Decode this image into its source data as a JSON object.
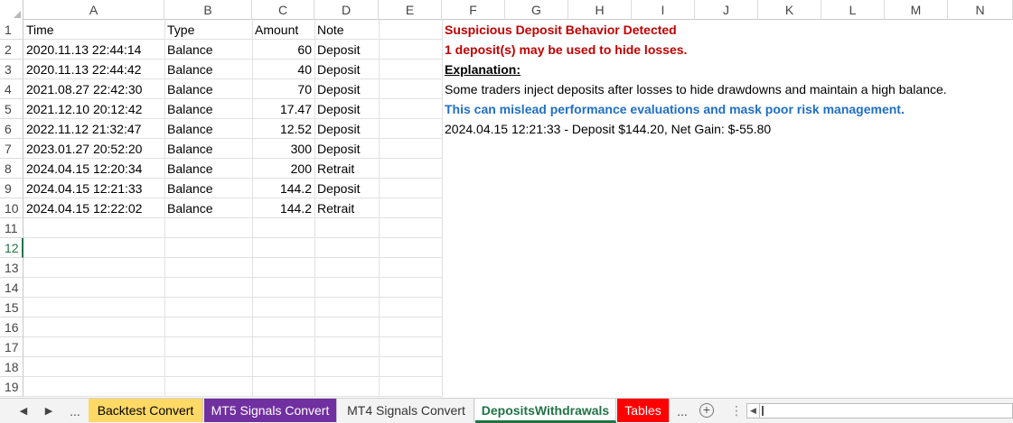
{
  "columns": [
    "A",
    "B",
    "C",
    "D",
    "E",
    "F",
    "G",
    "H",
    "I",
    "J",
    "K",
    "L",
    "M",
    "N"
  ],
  "rows": [
    "1",
    "2",
    "3",
    "4",
    "5",
    "6",
    "7",
    "8",
    "9",
    "10",
    "11",
    "12",
    "13",
    "14",
    "15",
    "16",
    "17",
    "18",
    "19"
  ],
  "active_row": "12",
  "table": {
    "headers": [
      "Time",
      "Type",
      "Amount",
      "Note"
    ],
    "records": [
      [
        "2020.11.13 22:44:14",
        "Balance",
        "60",
        "Deposit"
      ],
      [
        "2020.11.13 22:44:42",
        "Balance",
        "40",
        "Deposit"
      ],
      [
        "2021.08.27 22:42:30",
        "Balance",
        "70",
        "Deposit"
      ],
      [
        "2021.12.10 20:12:42",
        "Balance",
        "17.47",
        "Deposit"
      ],
      [
        "2022.11.12 21:32:47",
        "Balance",
        "12.52",
        "Deposit"
      ],
      [
        "2023.01.27 20:52:20",
        "Balance",
        "300",
        "Deposit"
      ],
      [
        "2024.04.15 12:20:34",
        "Balance",
        "200",
        "Retrait"
      ],
      [
        "2024.04.15 12:21:33",
        "Balance",
        "144.2",
        "Deposit"
      ],
      [
        "2024.04.15 12:22:02",
        "Balance",
        "144.2",
        "Retrait"
      ]
    ]
  },
  "analysis": {
    "title": "Suspicious Deposit Behavior Detected",
    "summary": "1 deposit(s) may be used to hide losses.",
    "explanation_label": "Explanation:",
    "explanation_text": "Some traders inject deposits after losses to hide drawdowns and maintain a high balance.",
    "warning": "This can mislead performance evaluations and mask poor risk management.",
    "detail": "2024.04.15 12:21:33 - Deposit $144.20, Net Gain: $-55.80"
  },
  "tabs": {
    "prev_icon": "chevron-left-icon",
    "next_icon": "chevron-right-icon",
    "more_left": "...",
    "items": [
      {
        "label": "Backtest Convert",
        "bg": "#ffd966",
        "color": "#000000"
      },
      {
        "label": "MT5 Signals Convert",
        "bg": "#7030a0",
        "color": "#ffffff"
      },
      {
        "label": "MT4 Signals Convert",
        "bg": "#f3f3f3",
        "color": "#333333"
      },
      {
        "label": "DepositsWithdrawals",
        "bg": "#ffffff",
        "color": "#217346"
      },
      {
        "label": "Tables",
        "bg": "#ff0000",
        "color": "#ffffff"
      }
    ],
    "active_tab": "DepositsWithdrawals",
    "more_right": "...",
    "add_icon": "plus-circle-icon",
    "add_label": "+"
  },
  "colors": {
    "accent": "#217346",
    "red_text": "#c00000",
    "blue_text": "#1f6fc4"
  }
}
